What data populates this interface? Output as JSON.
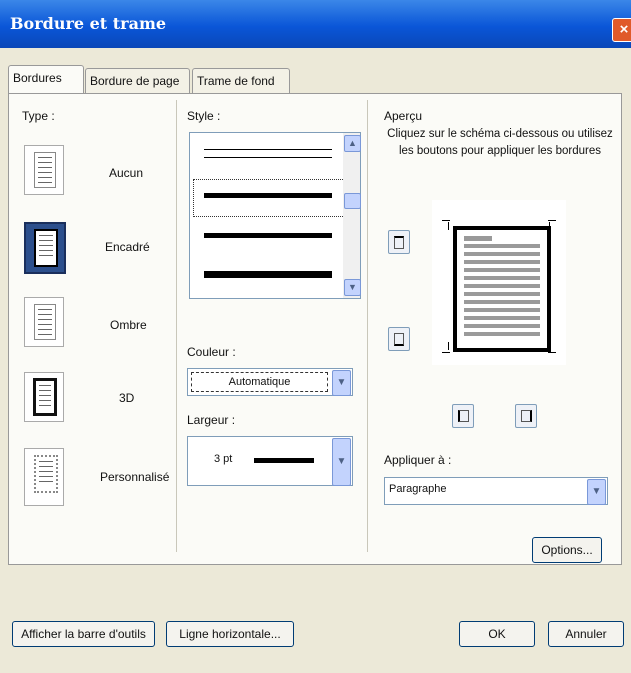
{
  "window": {
    "title": "Bordure et trame",
    "close_glyph": "×"
  },
  "tabs": [
    {
      "label": "Bordures",
      "active": true
    },
    {
      "label": "Bordure de page",
      "active": false
    },
    {
      "label": "Trame de fond",
      "active": false
    }
  ],
  "type_section": {
    "label": "Type :",
    "options": [
      {
        "label": "Aucun",
        "icon": "border-none-icon"
      },
      {
        "label": "Encadré",
        "icon": "border-box-icon",
        "selected": true
      },
      {
        "label": "Ombre",
        "icon": "border-shadow-icon"
      },
      {
        "label": "3D",
        "icon": "border-3d-icon"
      },
      {
        "label": "Personnalisé",
        "icon": "border-custom-icon"
      }
    ]
  },
  "style_section": {
    "label": "Style :"
  },
  "color": {
    "label": "Couleur :",
    "value": "Automatique"
  },
  "width": {
    "label": "Largeur :",
    "value": "3 pt"
  },
  "preview": {
    "label": "Aperçu",
    "instructions": "Cliquez sur le schéma ci-dessous ou utilisez les boutons pour appliquer les bordures"
  },
  "apply_to": {
    "label": "Appliquer à :",
    "value": "Paragraphe"
  },
  "buttons": {
    "options": "Options...",
    "toolbar": "Afficher la barre d'outils",
    "horizontal_line": "Ligne horizontale...",
    "ok": "OK",
    "cancel": "Annuler"
  },
  "colors": {
    "titlebar": "#0a56d8",
    "dialog_bg": "#ece9d8",
    "selected_type": "#2c4f8c"
  }
}
